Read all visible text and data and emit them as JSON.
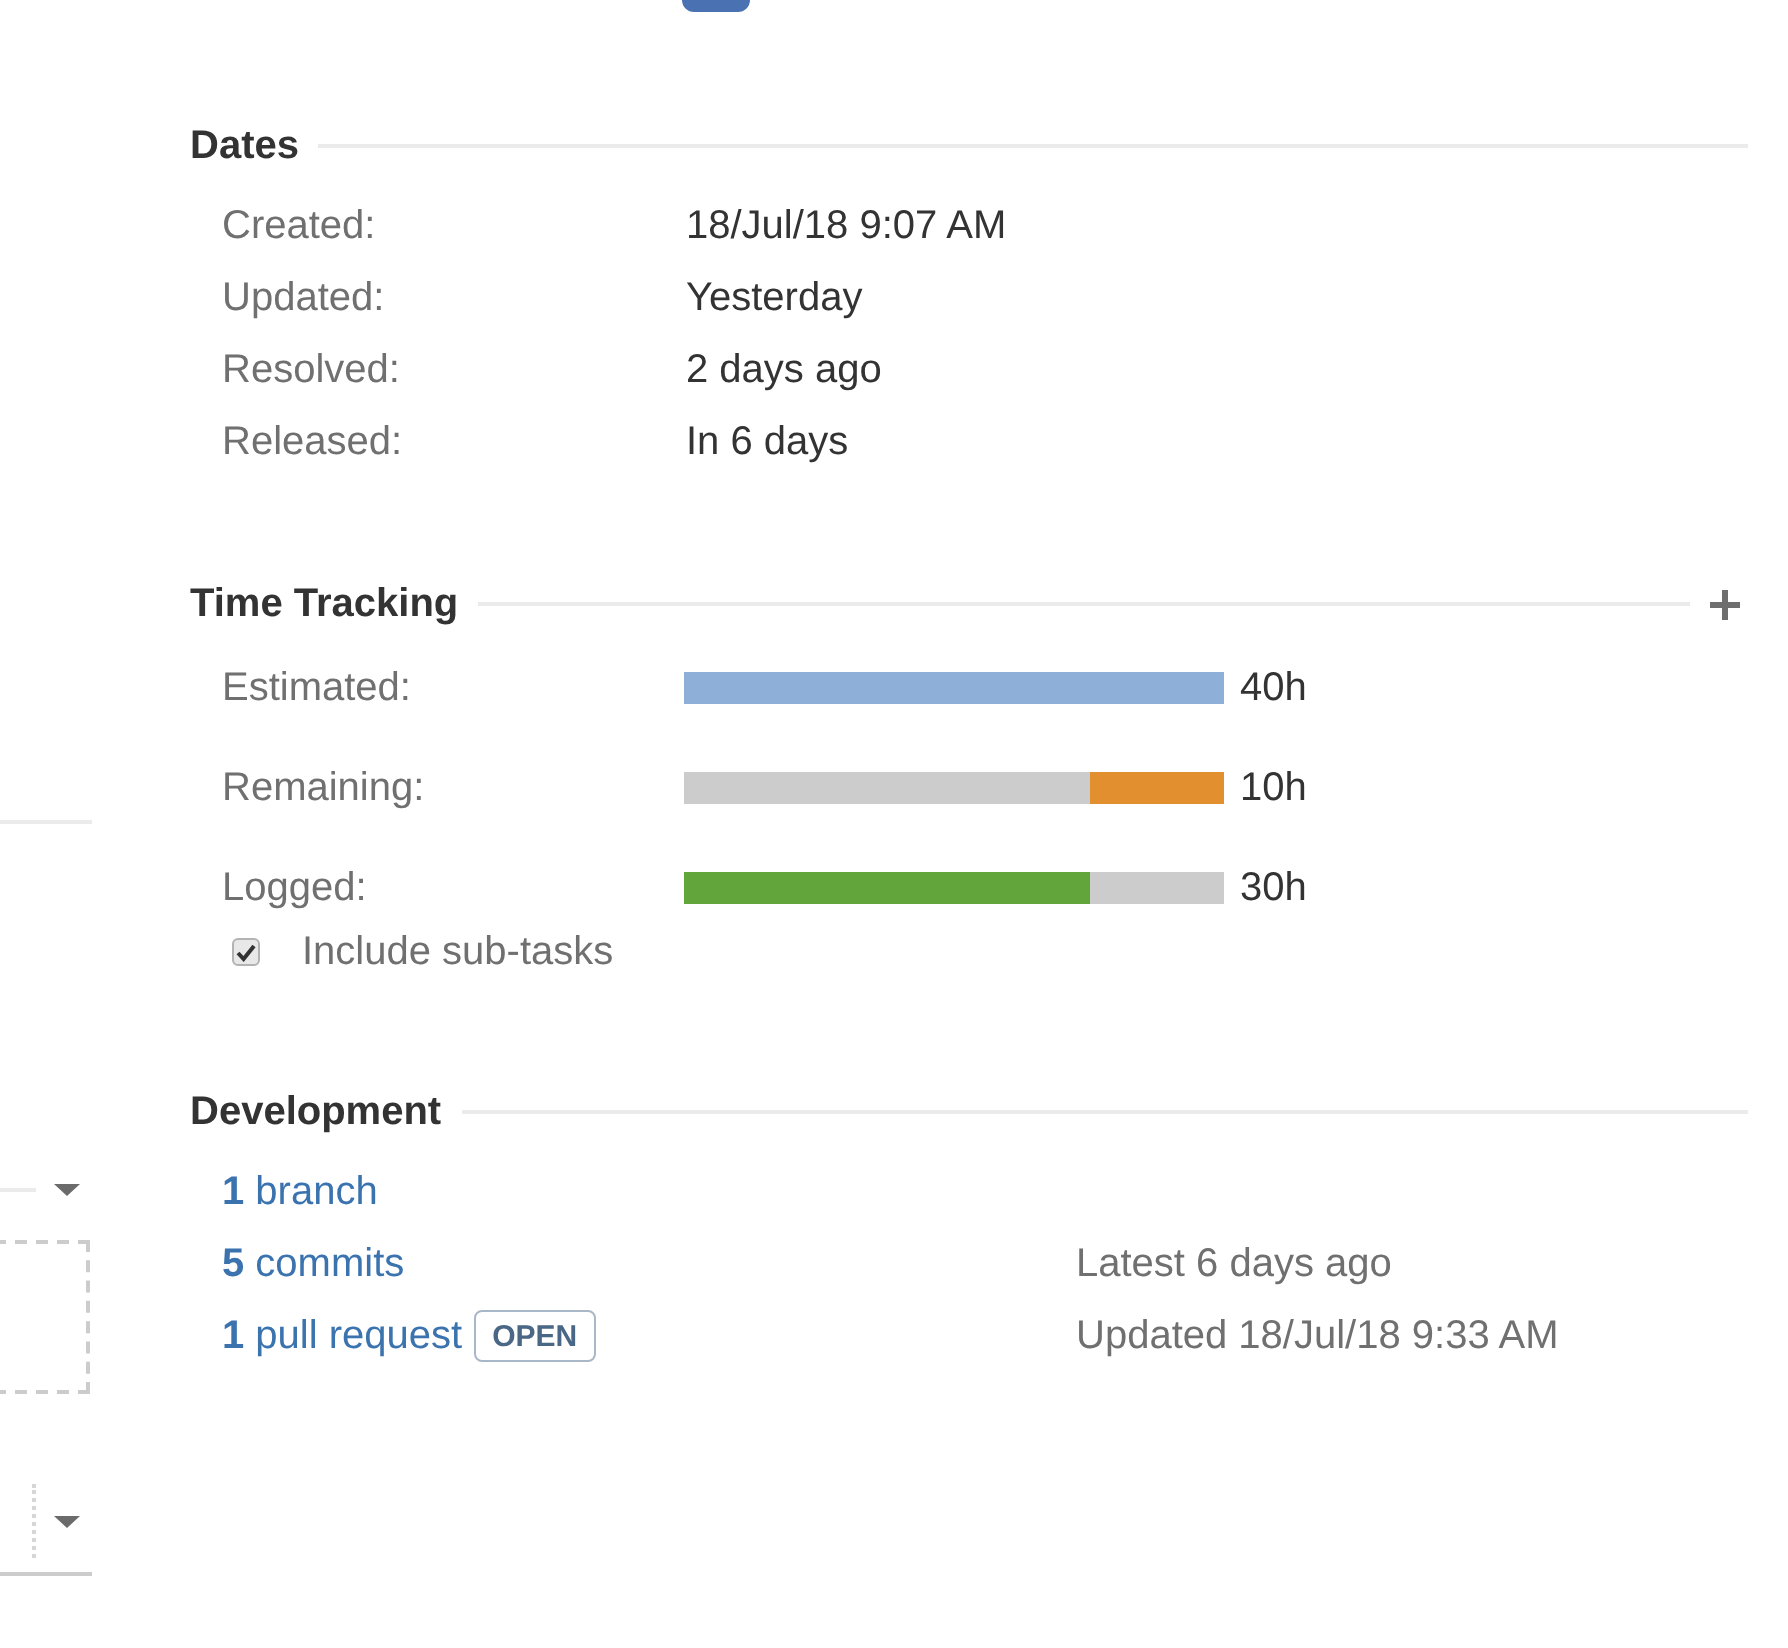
{
  "dates": {
    "title": "Dates",
    "rows": [
      {
        "label": "Created:",
        "value": "18/Jul/18 9:07 AM"
      },
      {
        "label": "Updated:",
        "value": "Yesterday"
      },
      {
        "label": "Resolved:",
        "value": "2 days ago"
      },
      {
        "label": "Released:",
        "value": "In 6 days"
      }
    ]
  },
  "time_tracking": {
    "title": "Time Tracking",
    "rows": [
      {
        "kind": "estimated",
        "label": "Estimated:",
        "level": 1,
        "reading": "40h"
      },
      {
        "kind": "remaining",
        "label": "Remaining:",
        "level": 0.25,
        "reading": "10h"
      },
      {
        "kind": "logged",
        "label": "Logged:",
        "level": 0.75,
        "reading": "30h"
      }
    ],
    "include_subtasks": {
      "label": "Include sub-tasks",
      "checked": true
    }
  },
  "development": {
    "title": "Development",
    "items": [
      {
        "link": "**1** branch"
      },
      {
        "link": "**5** commits",
        "detail": "Latest 6 days ago"
      },
      {
        "link": "**1** pull request",
        "status": "OPEN",
        "detail": "Updated 18/Jul/18 9:33 AM"
      }
    ]
  }
}
